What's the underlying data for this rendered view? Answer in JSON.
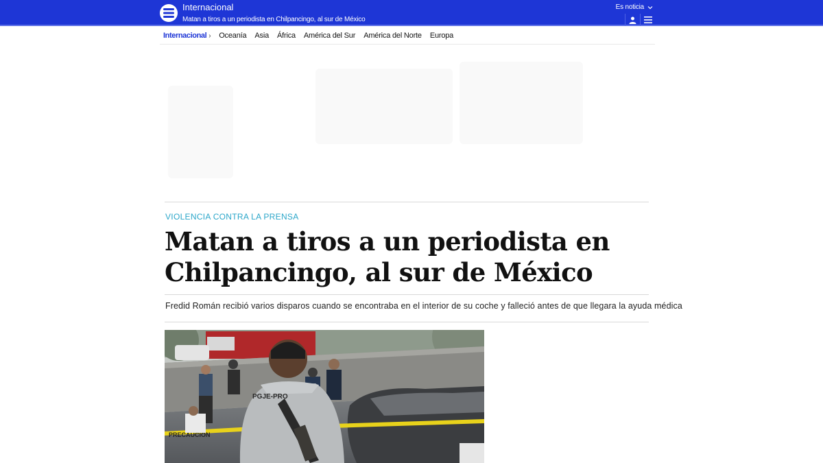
{
  "header": {
    "section_title": "Internacional",
    "headline": "Matan a tiros a un periodista en Chilpancingo, al sur de México",
    "es_noticia_label": "Es noticia",
    "logo_icon": "logo-menu-icon",
    "user_icon": "user-icon",
    "menu_icon": "hamburger-icon"
  },
  "subnav": {
    "current": "Internacional",
    "items": [
      "Oceanía",
      "Asia",
      "África",
      "América del Sur",
      "América del Norte",
      "Europa"
    ]
  },
  "article": {
    "kicker": "VIOLENCIA CONTRA LA PRENSA",
    "title_line1": "Matan a tiros a un periodista en",
    "title_line2": "Chilpancingo, al sur de México",
    "subtitle": "Fredid Román recibió varios disparos cuando se encontraba en el interior de su coche y falleció antes de que llegara la ayuda médica",
    "photo_vest_text": "PGJE-PRO",
    "photo_tape_text": "PRECAUCION"
  },
  "colors": {
    "brand_blue": "#1e36d6",
    "kicker_teal": "#2aa6c9"
  }
}
